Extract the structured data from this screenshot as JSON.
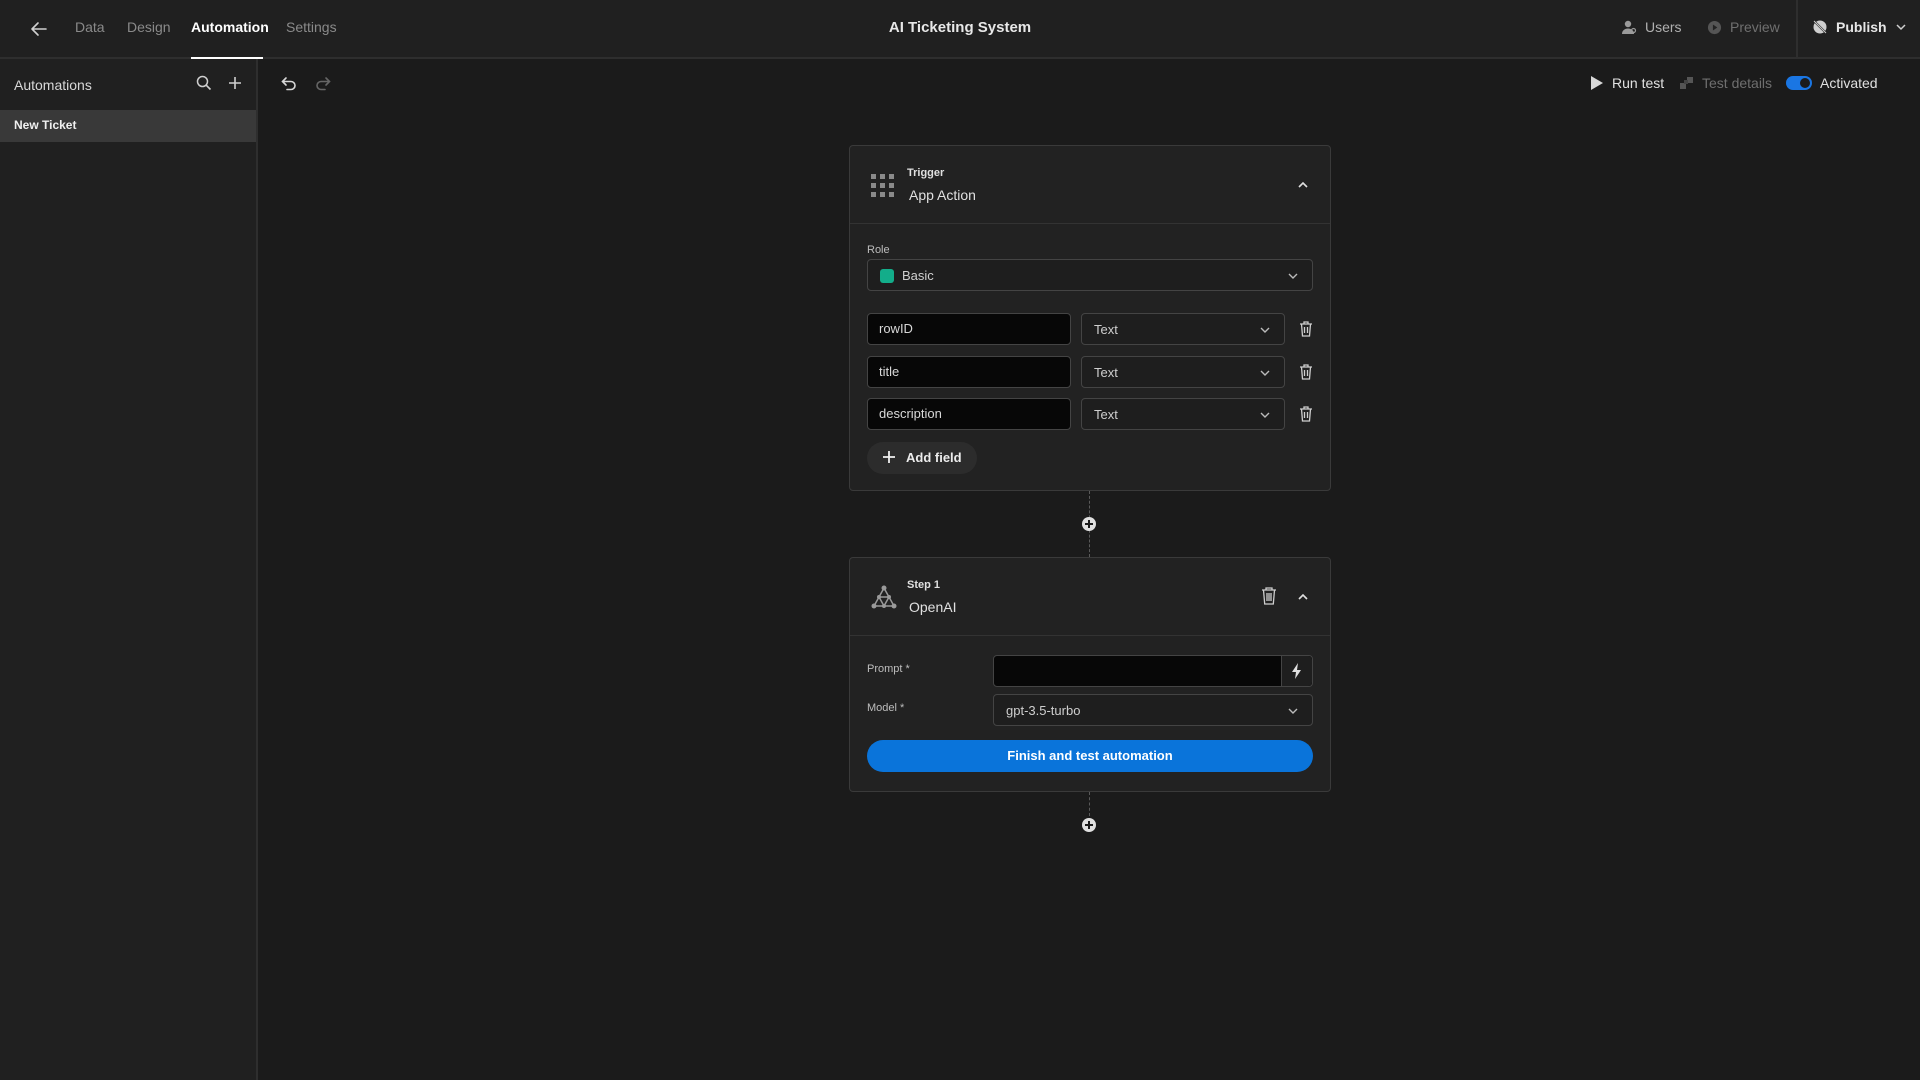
{
  "header": {
    "nav_tabs": [
      {
        "label": "Data",
        "active": false
      },
      {
        "label": "Design",
        "active": false
      },
      {
        "label": "Automation",
        "active": true
      },
      {
        "label": "Settings",
        "active": false
      }
    ],
    "app_title": "AI Ticketing System",
    "users_label": "Users",
    "preview_label": "Preview",
    "publish_label": "Publish"
  },
  "sidebar": {
    "title": "Automations",
    "items": [
      {
        "label": "New Ticket",
        "selected": true
      }
    ]
  },
  "toolbar": {
    "run_test_label": "Run test",
    "test_details_label": "Test details",
    "activated_label": "Activated",
    "activated": true
  },
  "trigger": {
    "kicker": "Trigger",
    "name": "App Action",
    "role_label": "Role",
    "role_value": "Basic",
    "role_color": "#13ad8a",
    "fields": [
      {
        "name": "rowID",
        "type": "Text"
      },
      {
        "name": "title",
        "type": "Text"
      },
      {
        "name": "description",
        "type": "Text"
      }
    ],
    "add_field_label": "Add field"
  },
  "step": {
    "kicker": "Step 1",
    "name": "OpenAI",
    "prompt_label": "Prompt *",
    "prompt_value": "",
    "model_label": "Model *",
    "model_value": "gpt-3.5-turbo",
    "finish_label": "Finish and test automation"
  },
  "colors": {
    "accent": "#0a74da",
    "toggle_on": "#1a76e3"
  }
}
